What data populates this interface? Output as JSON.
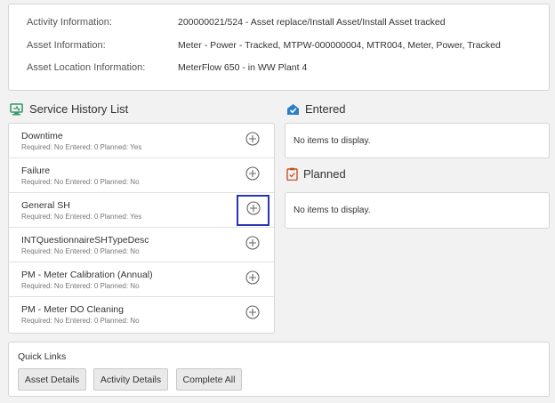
{
  "activity": {
    "fields": [
      {
        "label": "Activity Information:",
        "value": "200000021/524 - Asset replace/Install Asset/Install Asset tracked"
      },
      {
        "label": "Asset Information:",
        "value": "Meter - Power - Tracked, MTPW-000000004, MTR004, Meter, Power, Tracked"
      },
      {
        "label": "Asset Location Information:",
        "value": "MeterFlow 650 - in WW Plant 4"
      }
    ]
  },
  "service_history": {
    "title": "Service History List",
    "items": [
      {
        "name": "Downtime",
        "meta": "Required: No   Entered: 0   Planned: Yes"
      },
      {
        "name": "Failure",
        "meta": "Required: No   Entered: 0   Planned: No"
      },
      {
        "name": "General SH",
        "meta": "Required: No   Entered: 0   Planned: Yes"
      },
      {
        "name": "INTQuestionnaireSHTypeDesc",
        "meta": "Required: No   Entered: 0   Planned: No"
      },
      {
        "name": "PM - Meter Calibration (Annual)",
        "meta": "Required: No   Entered: 0   Planned: No"
      },
      {
        "name": "PM - Meter DO Cleaning",
        "meta": "Required: No   Entered: 0   Planned: No"
      }
    ]
  },
  "entered": {
    "title": "Entered",
    "empty": "No items to display."
  },
  "planned": {
    "title": "Planned",
    "empty": "No items to display."
  },
  "quick_links": {
    "title": "Quick Links",
    "buttons": [
      "Asset Details",
      "Activity Details",
      "Complete All"
    ]
  },
  "colors": {
    "focus": "#2b34b8",
    "icon_green": "#3a9a6b",
    "icon_blue": "#2d7fc1",
    "icon_orange": "#c0532a"
  }
}
